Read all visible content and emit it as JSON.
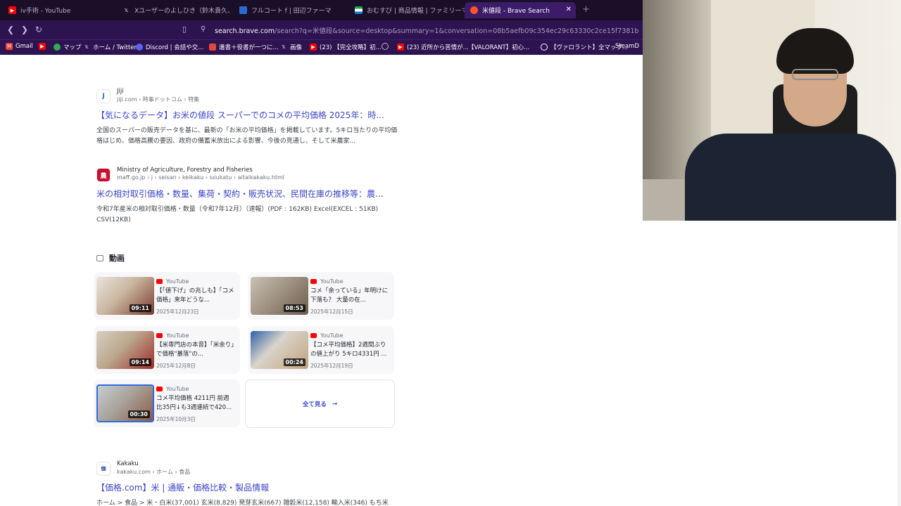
{
  "browser": {
    "tabs": [
      {
        "label": "iv手術 - YouTube",
        "icon": "youtube-icon",
        "active": false
      },
      {
        "label": "Xユーザーのよしひき（鈴木貴久、ようちゃ",
        "icon": "x-icon",
        "active": false
      },
      {
        "label": "フルコート f | 田辺ファーマ",
        "icon": "page-icon",
        "active": false
      },
      {
        "label": "おむすび | 商品情報 | ファミリーマート",
        "icon": "familymart-icon",
        "active": false
      },
      {
        "label": "米値段 - Brave Search",
        "icon": "brave-icon",
        "active": true
      }
    ],
    "tab_close": "✕",
    "new_tab": "+",
    "url_host": "search.brave.com",
    "url_rest": "/search?q=米値段&source=desktop&summary=1&conversation=08b5aefb09c354ec29c63330c2ce15f7381b",
    "bookmarks": [
      {
        "label": "Gmail",
        "icon": "gmail-icon",
        "color": "#ea4335"
      },
      {
        "label": "",
        "icon": "youtube-icon",
        "color": "#ff0000"
      },
      {
        "label": "マップ",
        "icon": "maps-icon",
        "color": "#34a853"
      },
      {
        "label": "ホーム / Twitter",
        "icon": "x-icon",
        "color": "#000000"
      },
      {
        "label": "Discord | 会話や交...",
        "icon": "discord-icon",
        "color": "#5865f2"
      },
      {
        "label": "遺書＋役書が一つに...",
        "icon": "bookmark-icon",
        "color": "#e0483b"
      },
      {
        "label": "画像",
        "icon": "x-icon",
        "color": "#000000"
      },
      {
        "label": "(23) 【完全攻略】初...",
        "icon": "youtube-icon",
        "color": "#ff0000"
      },
      {
        "label": "",
        "icon": "globe-icon",
        "color": "#888888"
      },
      {
        "label": "(23) 近所から苦情が...",
        "icon": "youtube-icon",
        "color": "#ff0000"
      },
      {
        "label": "【VALORANT】初心...",
        "icon": "page-icon",
        "color": "#888888"
      },
      {
        "label": "【ヴァロラント】全マップ...",
        "icon": "page-icon",
        "color": "#3b5bdb"
      },
      {
        "label": "SteamD",
        "icon": "steam-icon",
        "color": "#1b2838"
      }
    ]
  },
  "results": [
    {
      "source_name": "Jiji",
      "source_path": "jiji.com › 時事ドットコム › 特集",
      "icon": "jiji-icon",
      "title": "【気になるデータ】お米の値段 スーパーでのコメの平均価格 2025年：時...",
      "desc": "全国のスーパーの販売データを基に、最新の「お米の平均価格」を掲載しています。5キロ当たりの平均価格はじめ、価格高騰の要因、政府の備蓄米放出による影響、今後の見通し、そして米農家..."
    },
    {
      "source_name": "Ministry of Agriculture, Forestry and Fisheries",
      "source_path": "maff.go.jp › j › seisan › keikaku › soukatu › aitaikakaku.html",
      "icon": "maff-icon",
      "title": "米の相対取引価格・数量、集荷・契約・販売状況、民間在庫の推移等：農...",
      "desc": "令和7年産米の相対取引価格・数量（令和7年12月）（速報）(PDF : 162KB) Excel(EXCEL : 51KB) CSV(12KB)"
    },
    {
      "source_name": "Kakaku",
      "source_path": "kakaku.com › ホーム › 食品",
      "icon": "kakaku-icon",
      "title": "【価格.com】米 | 通販・価格比較・製品情報",
      "desc": "ホーム > 食品 > 米・白米(37,001) 玄米(8,829) 発芽玄米(667) 雑穀米(12,158) 輸入米(346) もち米"
    }
  ],
  "videos": {
    "heading": "動画",
    "see_all": "全て見る",
    "items": [
      {
        "source": "YouTube",
        "title": "【「値下げ」の兆しも】「コメ価格」来年どうな...",
        "date": "2025年12月23日",
        "duration": "09:11"
      },
      {
        "source": "YouTube",
        "title": "コメ「余っている」年明けに下落も？ 大量の在...",
        "date": "2025年12月15日",
        "duration": "08:53"
      },
      {
        "source": "YouTube",
        "title": "【米専門店の本音】「米余り」で価格\"暴落\"の...",
        "date": "2025年12月8日",
        "duration": "09:14"
      },
      {
        "source": "YouTube",
        "title": "【コメ平均価格】2週間ぶりの値上がり 5キロ4331円 ...",
        "date": "2025年12月19日",
        "duration": "00:24"
      },
      {
        "source": "YouTube",
        "title": "コメ平均価格 4211円 前週比35円↓も3週連続で420...",
        "date": "2025年10月3日",
        "duration": "00:30"
      }
    ]
  }
}
